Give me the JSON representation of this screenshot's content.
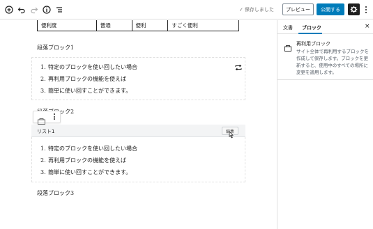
{
  "toolbar": {
    "saved_text": "保存しました",
    "preview_label": "プレビュー",
    "publish_label": "公開する",
    "icons": [
      "add-icon",
      "undo-icon",
      "redo-icon",
      "info-icon",
      "list-view-icon",
      "gear-icon",
      "more-vertical-icon"
    ]
  },
  "editor": {
    "table_row": [
      "便利度",
      "普通",
      "便利",
      "すごく便利"
    ],
    "para1": "段落ブロック1",
    "list1": [
      {
        "num": "1.",
        "text": "特定のブロックを使い回したい場合"
      },
      {
        "num": "2.",
        "text": "再利用ブロックの機能を使えば"
      },
      {
        "num": "3.",
        "text": "簡単に使い回すことができます。"
      }
    ],
    "para2": "段落ブロック2",
    "reusable_bar": {
      "title": "リスト1",
      "edit_label": "編集"
    },
    "list2": [
      {
        "num": "1.",
        "text": "特定のブロックを使い回したい場合"
      },
      {
        "num": "2.",
        "text": "再利用ブロックの機能を使えば"
      },
      {
        "num": "3.",
        "text": "簡単に使い回すことができます。"
      }
    ],
    "para3": "段落ブロック3"
  },
  "sidebar": {
    "tab_document": "文書",
    "tab_block": "ブロック",
    "close": "×",
    "block_title": "再利用ブロック",
    "block_desc": "サイト全体で再利用するブロックを作成して保存します。ブロックを更新すると、使用中のすべての場所に変更を適用します。"
  },
  "colors": {
    "accent": "#007cba",
    "dark": "#1e1e1e",
    "border": "#e0e0e0"
  }
}
